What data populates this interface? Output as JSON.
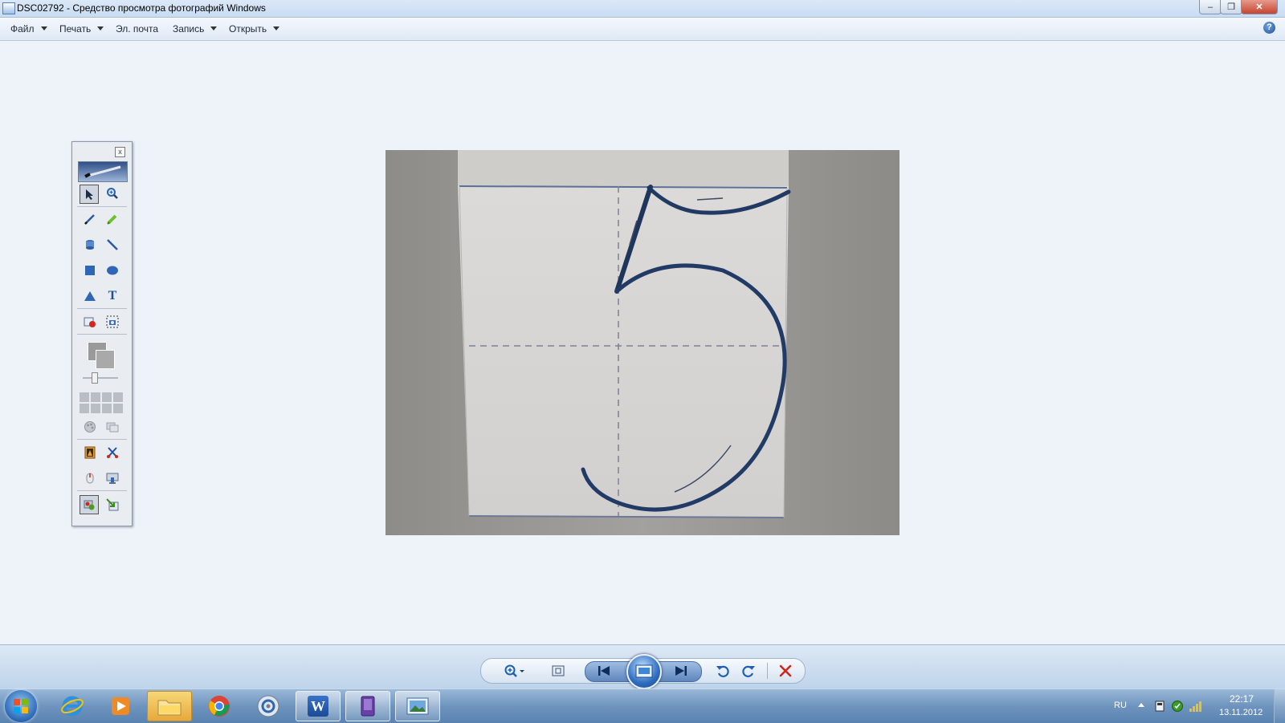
{
  "window": {
    "title": "DSC02792 - Средство просмотра фотографий Windows",
    "minimize_glyph": "–",
    "maximize_glyph": "❐",
    "close_glyph": "✕"
  },
  "menu": {
    "items": [
      {
        "label": "Файл",
        "has_dropdown": true
      },
      {
        "label": "Печать",
        "has_dropdown": true
      },
      {
        "label": "Эл. почта",
        "has_dropdown": false
      },
      {
        "label": "Запись",
        "has_dropdown": true
      },
      {
        "label": "Открыть",
        "has_dropdown": true
      }
    ],
    "help_glyph": "?"
  },
  "toolbox": {
    "close_glyph": "x",
    "tools": [
      "select-arrow-icon",
      "zoom-icon",
      "pen-icon",
      "highlighter-icon",
      "fill-bucket-icon",
      "line-icon",
      "rectangle-icon",
      "ellipse-icon",
      "triangle-icon",
      "text-icon",
      "record-icon",
      "screenshot-icon",
      "palette-icon",
      "layers-icon",
      "gallery-icon",
      "cut-icon",
      "mouse-icon",
      "display-icon",
      "stamp-icon",
      "export-icon"
    ],
    "text_tool_glyph": "T"
  },
  "photo": {
    "subject": "handwritten digit 5 on paper"
  },
  "controls": {
    "icons": [
      "zoom-icon",
      "fit-window-icon",
      "previous-icon",
      "slideshow-icon",
      "next-icon",
      "rotate-left-icon",
      "rotate-right-icon",
      "delete-icon"
    ],
    "delete_color": "#d0261c"
  },
  "taskbar": {
    "apps": [
      "internet-explorer-icon",
      "media-player-icon",
      "explorer-folder-icon",
      "chrome-icon",
      "disc-burner-icon",
      "word-icon",
      "ebook-icon",
      "photo-viewer-icon"
    ],
    "word_glyph": "W",
    "tray": {
      "language": "RU",
      "time": "22:17",
      "date": "13.11.2012"
    }
  },
  "colors": {
    "accent": "#2d6cc0",
    "ink": "#1e3558"
  }
}
